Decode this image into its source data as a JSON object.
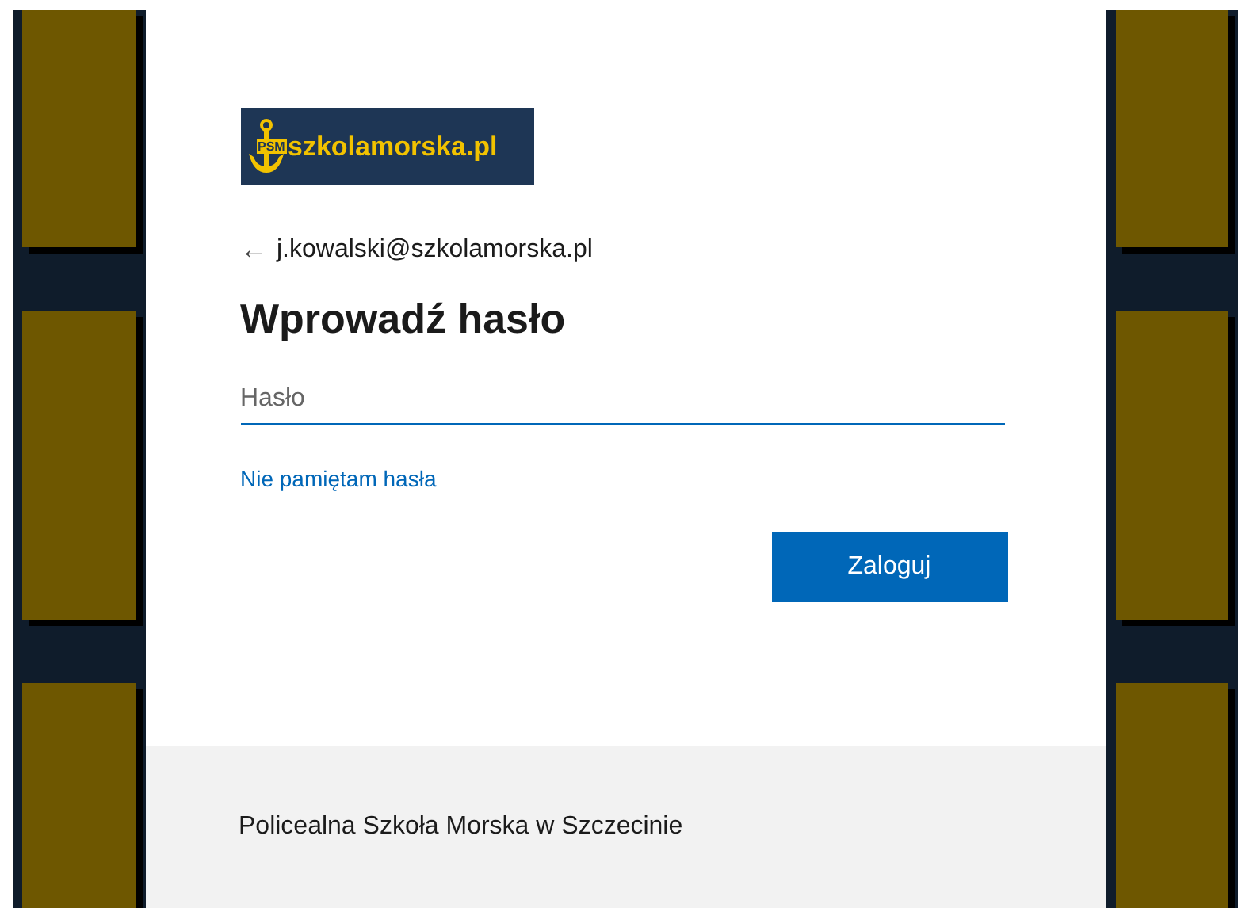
{
  "logo": {
    "text": "szkolamorska.pl",
    "badge": "PSM"
  },
  "account": {
    "back_arrow": "←",
    "email": "j.kowalski@szkolamorska.pl"
  },
  "title": "Wprowadź hasło",
  "password_field": {
    "placeholder": "Hasło"
  },
  "forgot_link": "Nie pamiętam hasła",
  "buttons": [
    {
      "label": "Zaloguj",
      "kind": "primary"
    }
  ],
  "footer": {
    "text": "Policealna Szkoła Morska w Szczecinie"
  }
}
